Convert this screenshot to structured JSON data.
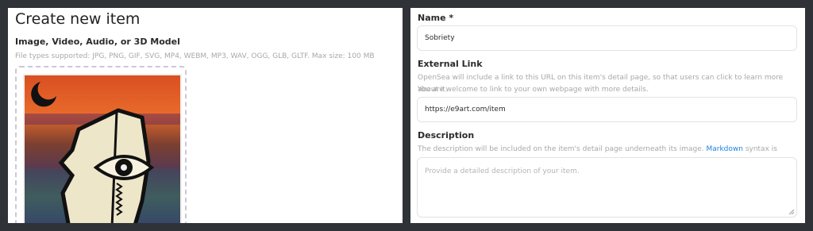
{
  "left_panel": {
    "title": "Create new item",
    "media": {
      "label": "Image, Video, Audio, or 3D Model",
      "help": "File types supported: JPG, PNG, GIF, SVG, MP4, WEBM, MP3, WAV, OGG, GLB, GLTF. Max size: 100 MB"
    }
  },
  "right_panel": {
    "name": {
      "label": "Name *",
      "value": "Sobriety"
    },
    "external_link": {
      "label": "External Link",
      "help_line1": "OpenSea will include a link to this URL on this item's detail page, so that users can click to learn more about it.",
      "help_line2": "You are welcome to link to your own webpage with more details.",
      "value": "https://e9art.com/item"
    },
    "description": {
      "label": "Description",
      "help_before": "The description will be included on the item's detail page underneath its image. ",
      "help_link": "Markdown",
      "help_after": " syntax is supported.",
      "placeholder": "Provide a detailed description of your item."
    }
  },
  "colors": {
    "background": "#2f3337",
    "link": "#2081e2"
  }
}
